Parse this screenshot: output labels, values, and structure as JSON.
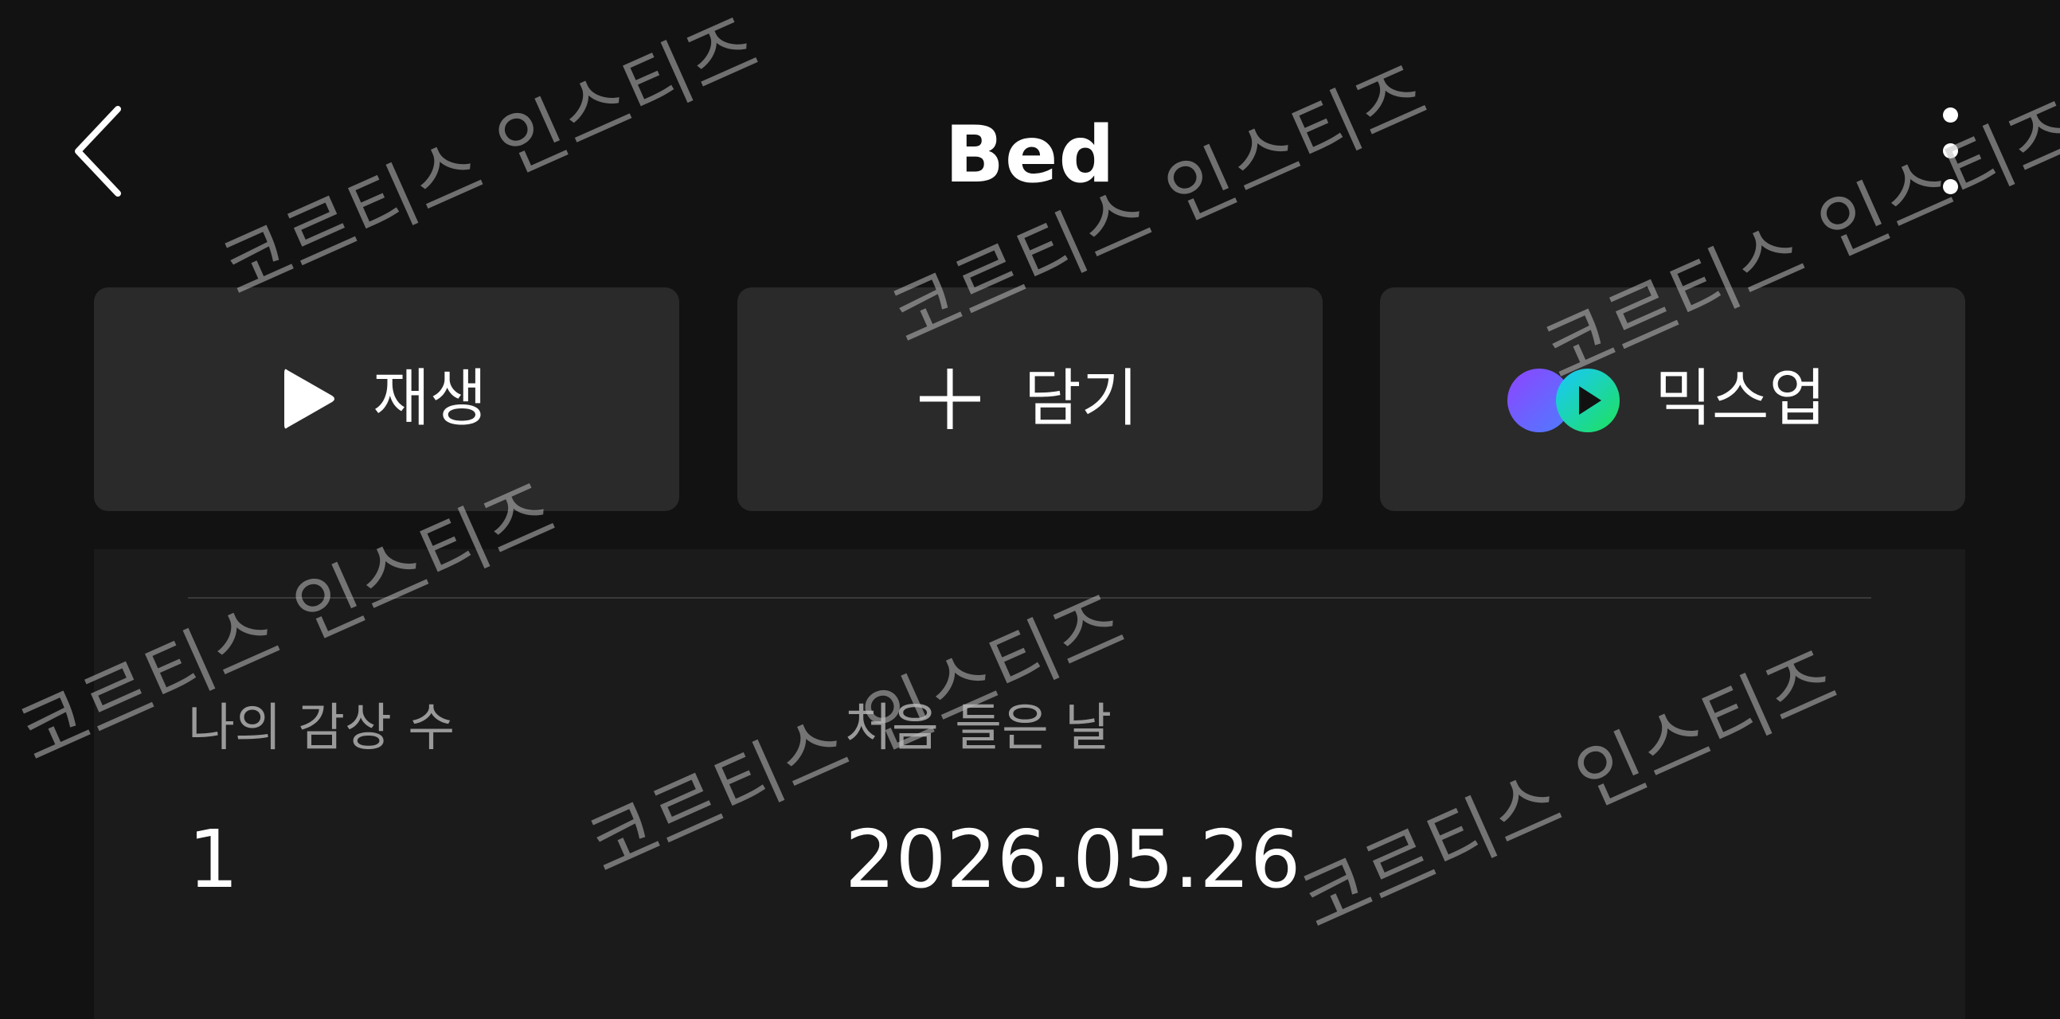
{
  "header": {
    "title": "Bed"
  },
  "actions": {
    "play_label": "재생",
    "add_label": "담기",
    "mixup_label": "믹스업"
  },
  "stats": {
    "play_count_label": "나의 감상 수",
    "play_count_value": "1",
    "first_listen_label": "처음 들은 날",
    "first_listen_value": "2026.05.26"
  },
  "watermark": {
    "text": "코르티스 인스티즈"
  },
  "colors": {
    "background": "#121212",
    "button_bg": "#2a2a2a",
    "card_bg": "#1b1b1b",
    "label_gray": "#9a9a9a",
    "mixup_purple": "#7c4dff",
    "mixup_green": "#1ed760"
  },
  "icons": {
    "back": "chevron-left-icon",
    "more": "vertical-dots-icon",
    "play": "play-icon",
    "add": "plus-icon",
    "mixup": "mixup-icon"
  }
}
